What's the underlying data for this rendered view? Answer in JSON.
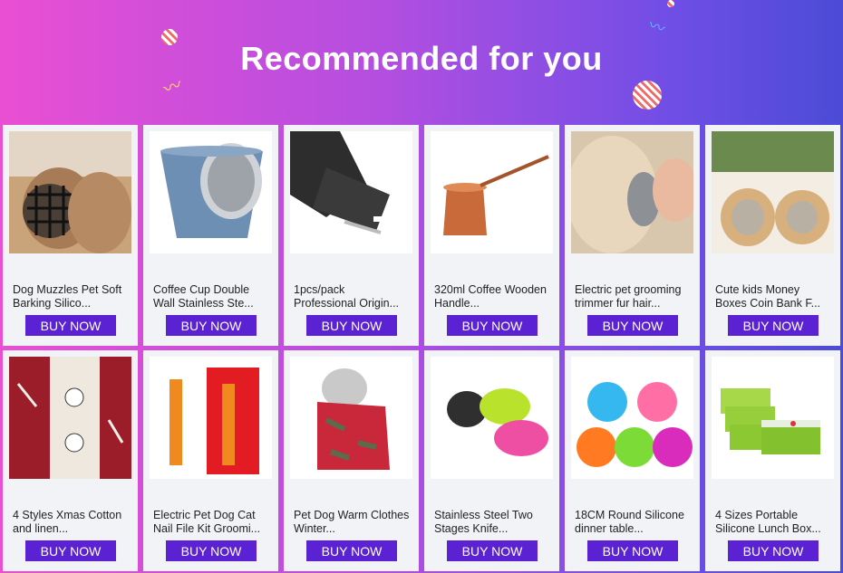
{
  "header": {
    "title": "Recommended for you"
  },
  "products": [
    {
      "title": "Dog Muzzles Pet Soft Barking Silico...",
      "button": "BUY NOW",
      "icon": "dog-muzzle-photo"
    },
    {
      "title": "Coffee Cup Double Wall Stainless Ste...",
      "button": "BUY NOW",
      "icon": "steel-cup-photo"
    },
    {
      "title": "1pcs/pack Professional Origin...",
      "button": "BUY NOW",
      "icon": "hair-clipper-photo"
    },
    {
      "title": "320ml Coffee Wooden Handle...",
      "button": "BUY NOW",
      "icon": "copper-coffee-pot-photo"
    },
    {
      "title": "Electric pet grooming trimmer fur hair...",
      "button": "BUY NOW",
      "icon": "pet-grooming-photo"
    },
    {
      "title": "Cute kids Money Boxes Coin Bank F...",
      "button": "BUY NOW",
      "icon": "coin-bank-photo"
    },
    {
      "title": "4 Styles Xmas Cotton and linen...",
      "button": "BUY NOW",
      "icon": "xmas-table-runner-photo"
    },
    {
      "title": "Electric Pet Dog Cat Nail File Kit Groomi...",
      "button": "BUY NOW",
      "icon": "nail-file-kit-photo"
    },
    {
      "title": "Pet Dog Warm Clothes Winter...",
      "button": "BUY NOW",
      "icon": "dog-clothes-photo"
    },
    {
      "title": "Stainless Steel Two Stages Knife...",
      "button": "BUY NOW",
      "icon": "knife-sharpener-photo"
    },
    {
      "title": "18CM Round Silicone dinner table...",
      "button": "BUY NOW",
      "icon": "silicone-mats-photo"
    },
    {
      "title": "4 Sizes Portable Silicone Lunch Box...",
      "button": "BUY NOW",
      "icon": "lunch-box-photo"
    }
  ],
  "colors": {
    "button": "#5b22d3",
    "card": "#f2f3f7",
    "title": "#ffffff"
  }
}
